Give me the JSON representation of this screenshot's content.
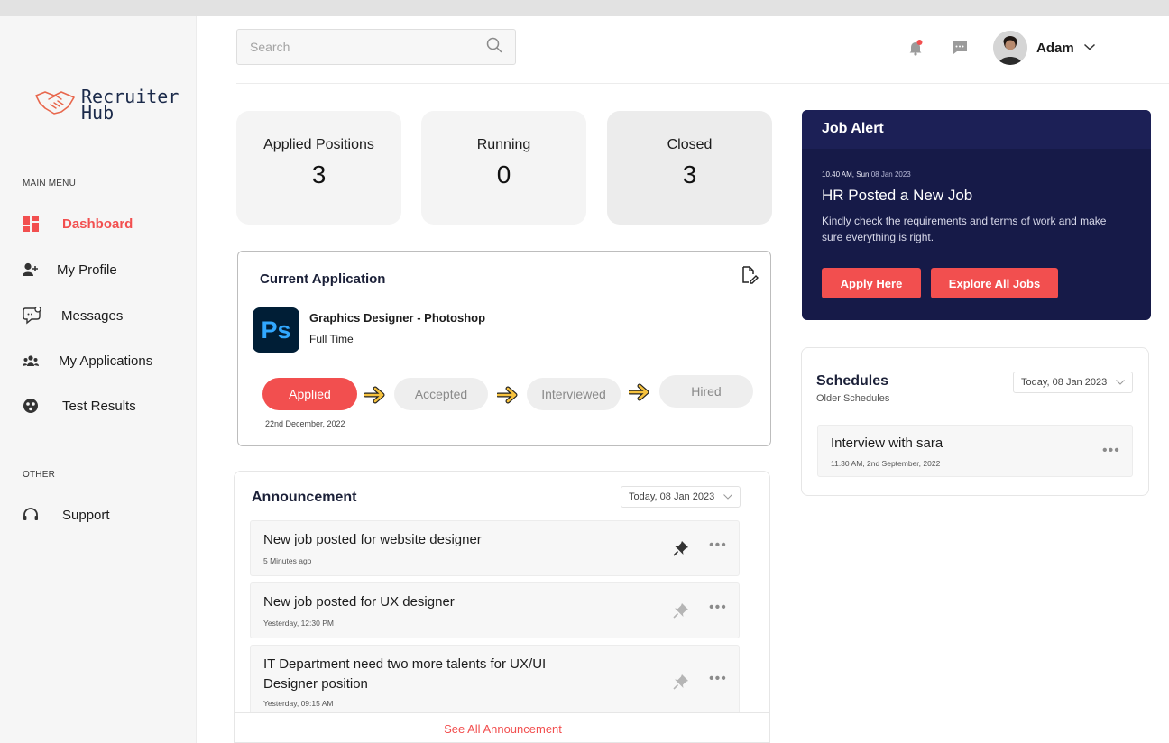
{
  "sidebar": {
    "logo_text_1": "Recruiter",
    "logo_text_2": "Hub",
    "main_menu_heading": "MAIN MENU",
    "items": [
      {
        "label": "Dashboard",
        "icon": "dashboard-icon",
        "active": true
      },
      {
        "label": "My Profile",
        "icon": "add-user-icon"
      },
      {
        "label": "Messages",
        "icon": "message-icon"
      },
      {
        "label": "My Applications",
        "icon": "group-icon"
      },
      {
        "label": "Test Results",
        "icon": "results-icon"
      }
    ],
    "other_heading": "OTHER",
    "support_label": "Support"
  },
  "header": {
    "search_placeholder": "Search",
    "user_name": "Adam"
  },
  "stats": [
    {
      "label": "Applied Positions",
      "value": "3"
    },
    {
      "label": "Running",
      "value": "0"
    },
    {
      "label": "Closed",
      "value": "3"
    }
  ],
  "current_application": {
    "title": "Current Application",
    "app_icon_text": "Ps",
    "job_title": "Graphics Designer - Photoshop",
    "job_type": "Full Time",
    "steps": [
      "Applied",
      "Accepted",
      "Interviewed",
      "Hired"
    ],
    "applied_date": "22nd December, 2022"
  },
  "announcement": {
    "title": "Announcement",
    "date_filter": "Today, 08 Jan 2023",
    "items": [
      {
        "title": "New job posted for website designer",
        "time": "5 Minutes ago"
      },
      {
        "title": "New job posted for UX designer",
        "time": "Yesterday, 12:30 PM"
      },
      {
        "title": "IT Department need two more talents for UX/UI Designer position",
        "time": "Yesterday, 09:15 AM"
      }
    ],
    "see_all": "See All Announcement"
  },
  "job_alert": {
    "title": "Job Alert",
    "timestamp_bold": "10.40 AM, Sun",
    "timestamp_date": "08 Jan 2023",
    "headline": "HR Posted a New Job",
    "body": "Kindly check the requirements and terms of work and make sure everything is right.",
    "apply_label": "Apply Here",
    "explore_label": "Explore All Jobs"
  },
  "schedules": {
    "title": "Schedules",
    "subtitle": "Older Schedules",
    "date_filter": "Today, 08 Jan 2023",
    "items": [
      {
        "title": "Interview with sara",
        "time": "11.30 AM, 2nd September, 2022"
      }
    ]
  },
  "colors": {
    "accent": "#f24f4f",
    "navy": "#161a48",
    "arrow_yellow": "#f6c23e"
  }
}
